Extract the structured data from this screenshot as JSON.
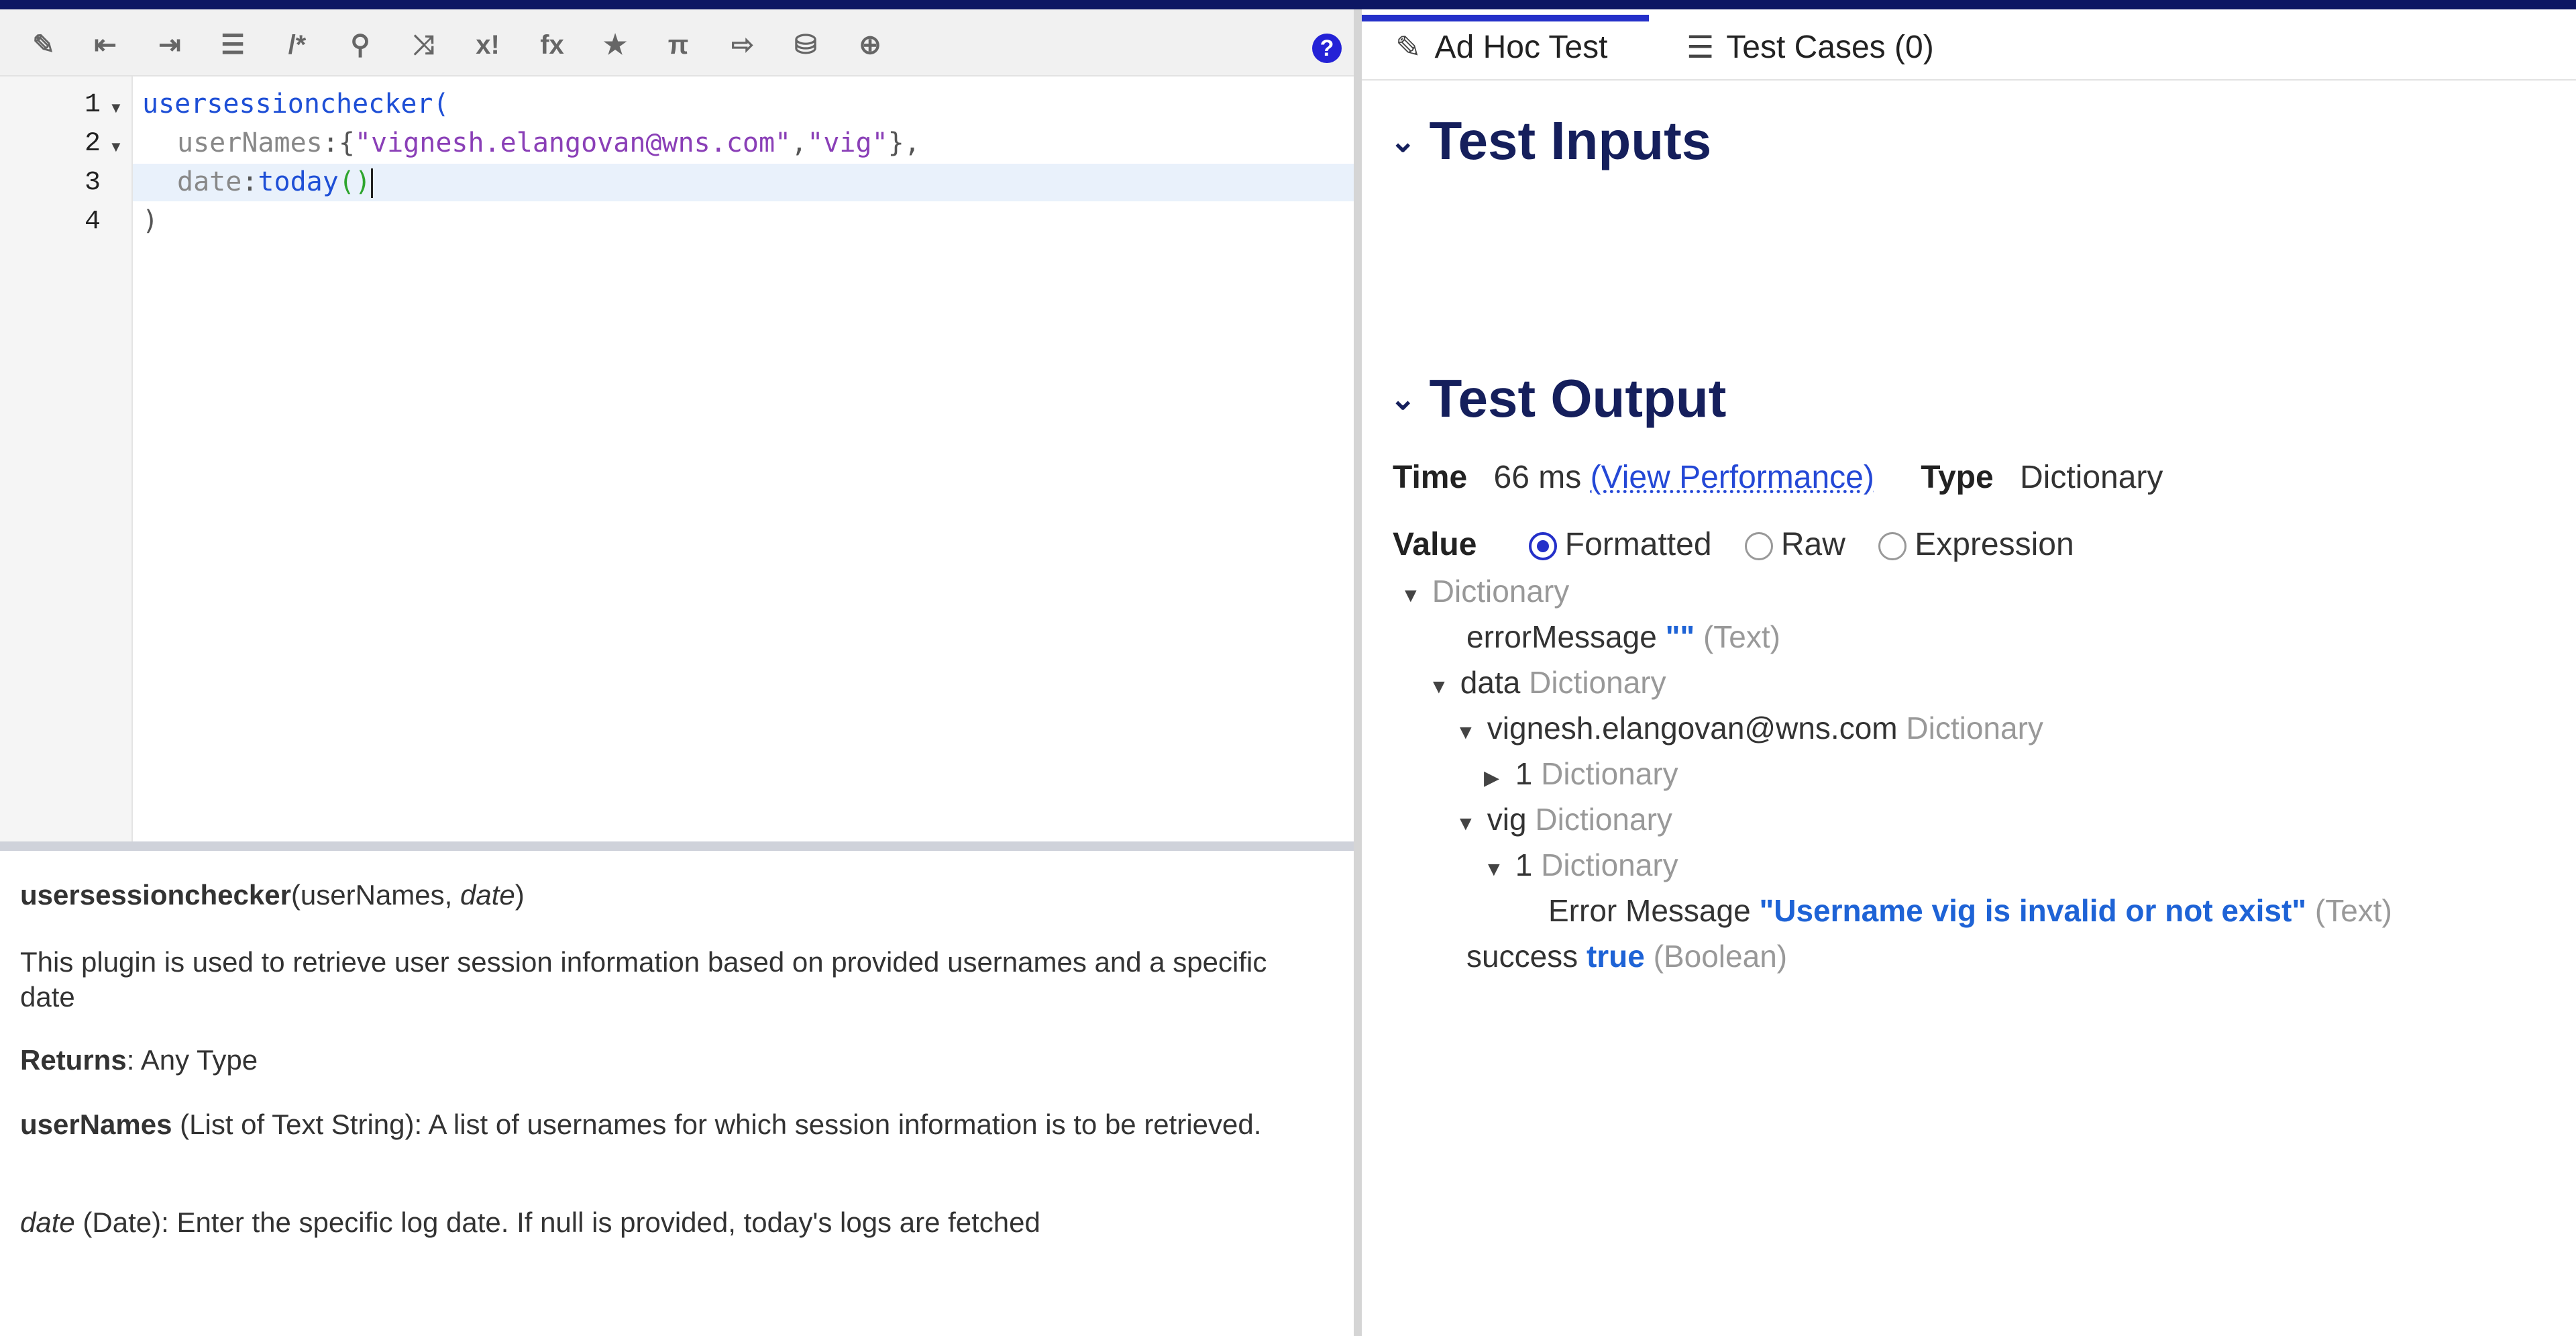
{
  "toolbar": {
    "icons": [
      "magic-wand-icon",
      "outdent-icon",
      "indent-icon",
      "list-icon",
      "comment-icon",
      "search-icon",
      "shuffle-icon",
      "factorial-icon",
      "function-icon",
      "star-icon",
      "pi-icon",
      "export-icon",
      "database-search-icon",
      "globe-icon"
    ],
    "glyphs": [
      "✎",
      "⇤",
      "⇥",
      "☰",
      "/*",
      "⚲",
      "⤨",
      "x!",
      "fx",
      "★",
      "π",
      "⇨",
      "⛁",
      "⊕"
    ],
    "help": "?"
  },
  "editor": {
    "line_numbers": [
      "1",
      "2",
      "3",
      "4"
    ],
    "line1": "usersessionchecker(",
    "line2_prop": "userNames",
    "line2_colon": ":{",
    "line2_str1": "\"vignesh.elangovan@wns.com\"",
    "line2_comma": ",",
    "line2_str2": "\"vig\"",
    "line2_end": "},",
    "line3_prop": "date",
    "line3_colon": ":",
    "line3_fn": "today",
    "line3_paren": "()",
    "line4": ")"
  },
  "doc": {
    "signature_name": "usersessionchecker",
    "signature_args_open": "(userNames, ",
    "signature_arg_date": "date",
    "signature_close": ")",
    "description": "This plugin is used to retrieve user session information based on provided usernames and a specific date",
    "returns_label": "Returns",
    "returns_value": ": Any Type",
    "param1_name": "userNames",
    "param1_desc": " (List of Text String): A list of usernames for which session information is to be retrieved.",
    "param2_name": "date",
    "param2_desc": " (Date): Enter the specific log date. If null is provided, today's logs are fetched"
  },
  "tabs": {
    "adhoc": "Ad Hoc Test",
    "cases": "Test Cases (0)"
  },
  "sections": {
    "inputs": "Test Inputs",
    "output": "Test Output"
  },
  "output": {
    "time_label": "Time",
    "time_value": "66 ms",
    "perf_link": "(View Performance)",
    "type_label": "Type",
    "type_value": "Dictionary",
    "value_label": "Value",
    "radio_formatted": "Formatted",
    "radio_raw": "Raw",
    "radio_expression": "Expression"
  },
  "tree": {
    "root": "Dictionary",
    "errorMessage_key": "errorMessage",
    "errorMessage_val": "\"\"",
    "errorMessage_type": "(Text)",
    "data_key": "data",
    "data_type": "Dictionary",
    "user1_key": "vignesh.elangovan@wns.com",
    "user1_type": "Dictionary",
    "user1_child_key": "1",
    "user1_child_type": "Dictionary",
    "user2_key": "vig",
    "user2_type": "Dictionary",
    "user2_child_key": "1",
    "user2_child_type": "Dictionary",
    "err_key": "Error Message",
    "err_val": "\"Username vig is invalid or not exist\"",
    "err_type": "(Text)",
    "success_key": "success",
    "success_val": "true",
    "success_type": "(Boolean)"
  }
}
